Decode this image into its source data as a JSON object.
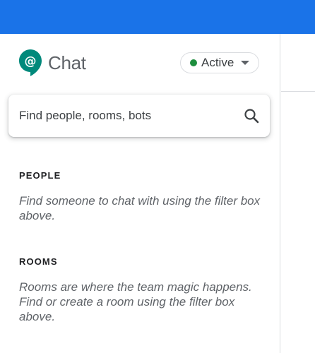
{
  "brand": {
    "title": "Chat",
    "logo_icon": "chat-bubble-at-icon",
    "logo_color": "#00897b"
  },
  "status": {
    "label": "Active",
    "dot_color": "#1e8e3e"
  },
  "search": {
    "placeholder": "Find people, rooms, bots"
  },
  "sections": {
    "people": {
      "heading": "PEOPLE",
      "text": "Find someone to chat with using the filter box above."
    },
    "rooms": {
      "heading": "ROOMS",
      "text": "Rooms are where the team magic happens. Find or create a room using the filter box above."
    }
  },
  "colors": {
    "topbar": "#1a73e8",
    "accent": "#1a73e8"
  }
}
